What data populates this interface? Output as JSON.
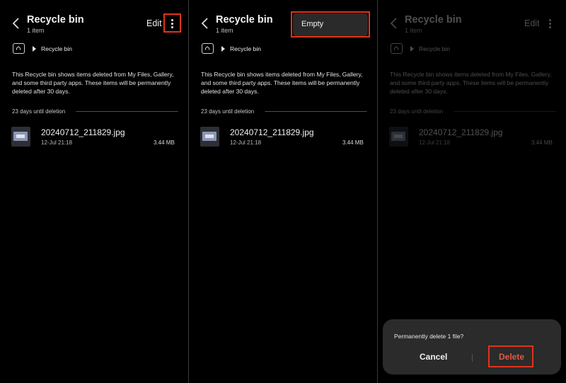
{
  "header": {
    "title": "Recycle bin",
    "subtitle": "1 item",
    "edit_label": "Edit"
  },
  "breadcrumb": {
    "label": "Recycle bin"
  },
  "description": "This Recycle bin shows items deleted from My Files, Gallery, and some third party apps. These items will be permanently deleted after 30 days.",
  "section": {
    "label": "23 days until deletion"
  },
  "file": {
    "name": "20240712_211829.jpg",
    "date": "12-Jul 21:18",
    "size": "3.44 MB"
  },
  "menu": {
    "empty_label": "Empty"
  },
  "dialog": {
    "question": "Permanently delete 1 file?",
    "cancel_label": "Cancel",
    "delete_label": "Delete"
  },
  "colors": {
    "background": "#000000",
    "highlight": "#e0331b",
    "delete_text": "#e35a3e",
    "dialog_bg": "#2b2b2b"
  }
}
